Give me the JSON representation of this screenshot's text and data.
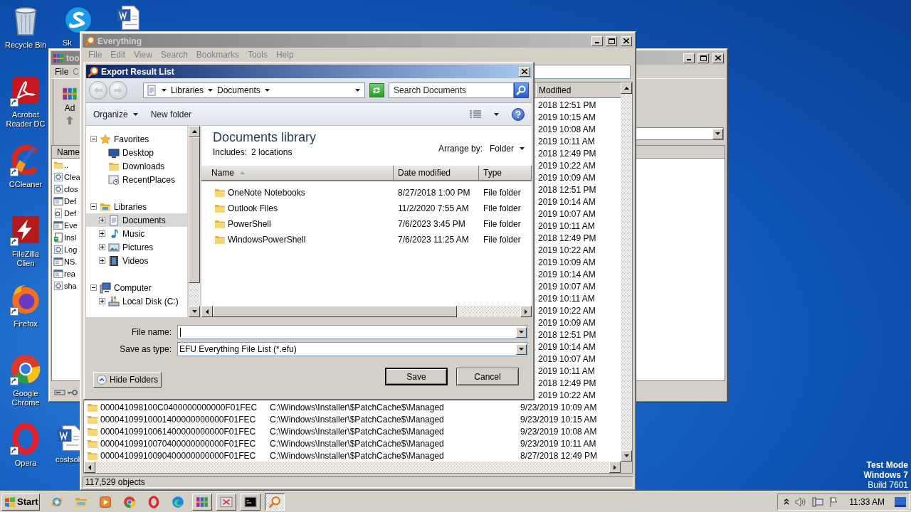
{
  "desktop": {
    "icons": [
      {
        "kind": "bin",
        "label": "Recycle Bin"
      },
      {
        "kind": "acrobat",
        "label": "Acrobat Reader DC"
      },
      {
        "kind": "ccleaner",
        "label": "CCleaner"
      },
      {
        "kind": "filezilla",
        "label": "FileZilla Clien"
      },
      {
        "kind": "firefox",
        "label": "Firefox"
      },
      {
        "kind": "chrome",
        "label": "Google Chrome"
      },
      {
        "kind": "opera",
        "label": "Opera"
      }
    ],
    "other_icons": [
      {
        "kind": "skype",
        "label": "Sk"
      },
      {
        "kind": "word"
      },
      {
        "kind": "word",
        "label": "costsol"
      }
    ],
    "system_text": [
      "Test Mode",
      "Windows 7",
      "Build 7601"
    ]
  },
  "back_window": {
    "title": "too",
    "menu": [
      "File",
      "C"
    ],
    "toolbar_button": "Ad",
    "column": "Name",
    "files": [
      {
        "name": "..",
        "kind": "folder"
      },
      {
        "name": "Clea",
        "kind": "gear"
      },
      {
        "name": "clos",
        "kind": "gear"
      },
      {
        "name": "Def",
        "kind": "window"
      },
      {
        "name": "Def",
        "kind": "settings"
      },
      {
        "name": "Eve",
        "kind": "window"
      },
      {
        "name": "Insl",
        "kind": "setup"
      },
      {
        "name": "Log",
        "kind": "gear"
      },
      {
        "name": "NS.",
        "kind": "window"
      },
      {
        "name": "rea",
        "kind": "window"
      },
      {
        "name": "sha",
        "kind": "gear"
      }
    ]
  },
  "everything": {
    "title": "Everything",
    "menu": [
      "File",
      "Edit",
      "View",
      "Search",
      "Bookmarks",
      "Tools",
      "Help"
    ],
    "header": "Modified",
    "covered_rows": [
      "2018 12:51 PM",
      "2019 10:15 AM",
      "2019 10:08 AM",
      "2019 10:11 AM",
      "2018 12:49 PM",
      "2019 10:22 AM",
      "2019 10:09 AM",
      "2018 12:51 PM",
      "2019 10:14 AM",
      "2019 10:07 AM",
      "2019 10:11 AM",
      "2018 12:49 PM",
      "2019 10:22 AM",
      "2019 10:09 AM",
      "2019 10:14 AM",
      "2019 10:07 AM",
      "2019 10:11 AM",
      "2019 10:22 AM",
      "2019 10:09 AM",
      "2018 12:51 PM",
      "2019 10:14 AM",
      "2019 10:07 AM",
      "2019 10:11 AM",
      "2018 12:49 PM",
      "2019 10:22 AM"
    ],
    "rows": [
      {
        "name": "000041098100C0400000000000F01FEC",
        "path": "C:\\Windows\\Installer\\$PatchCache$\\Managed",
        "modified": "9/23/2019 10:09 AM"
      },
      {
        "name": "00004109910001400000000000F01FEC",
        "path": "C:\\Windows\\Installer\\$PatchCache$\\Managed",
        "modified": "9/23/2019 10:15 AM"
      },
      {
        "name": "00004109910061400000000000F01FEC",
        "path": "C:\\Windows\\Installer\\$PatchCache$\\Managed",
        "modified": "9/23/2019 10:08 AM"
      },
      {
        "name": "00004109910070400000000000F01FEC",
        "path": "C:\\Windows\\Installer\\$PatchCache$\\Managed",
        "modified": "9/23/2019 10:11 AM"
      },
      {
        "name": "00004109910090400000000000F01FEC",
        "path": "C:\\Windows\\Installer\\$PatchCache$\\Managed",
        "modified": "8/27/2018 12:49 PM"
      }
    ],
    "status": "117,529 objects"
  },
  "dialog": {
    "title": "Export Result List",
    "breadcrumb": [
      "Libraries",
      "Documents"
    ],
    "search_placeholder": "Search Documents",
    "commands": [
      "Organize",
      "New folder"
    ],
    "nav": [
      {
        "label": "Favorites",
        "kind": "star",
        "expanded": true,
        "selected": false,
        "children": [
          {
            "label": "Desktop",
            "kind": "desktop",
            "selected": false
          },
          {
            "label": "Downloads",
            "kind": "folder",
            "selected": false
          },
          {
            "label": "RecentPlaces",
            "kind": "recent",
            "selected": false
          }
        ]
      },
      {
        "label": "Libraries",
        "kind": "libraries",
        "expanded": true,
        "selected": false,
        "children": [
          {
            "label": "Documents",
            "kind": "documents",
            "expanded": false,
            "selected": true
          },
          {
            "label": "Music",
            "kind": "music",
            "expanded": false,
            "selected": false
          },
          {
            "label": "Pictures",
            "kind": "pictures",
            "expanded": false,
            "selected": false
          },
          {
            "label": "Videos",
            "kind": "videos",
            "expanded": false,
            "selected": false
          }
        ]
      },
      {
        "label": "Computer",
        "kind": "computer",
        "expanded": true,
        "selected": false,
        "children": [
          {
            "label": "Local Disk (C:)",
            "kind": "disk",
            "expanded": false,
            "selected": false
          }
        ]
      }
    ],
    "library": {
      "title": "Documents library",
      "includes_label": "Includes:",
      "includes_value": "2 locations",
      "arrange_label": "Arrange by:",
      "arrange_value": "Folder"
    },
    "columns": [
      "Name",
      "Date modified",
      "Type"
    ],
    "files": [
      {
        "name": "OneNote Notebooks",
        "date": "8/27/2018 1:00 PM",
        "type": "File folder"
      },
      {
        "name": "Outlook Files",
        "date": "11/2/2020 7:55 AM",
        "type": "File folder"
      },
      {
        "name": "PowerShell",
        "date": "7/6/2023 3:45 PM",
        "type": "File folder"
      },
      {
        "name": "WindowsPowerShell",
        "date": "7/6/2023 11:25 AM",
        "type": "File folder"
      }
    ],
    "file_name_label": "File name:",
    "save_type_label": "Save as type:",
    "save_type_value": "EFU Everything File List (*.efu)",
    "hide_folders": "Hide Folders",
    "buttons": [
      "Save",
      "Cancel"
    ]
  },
  "taskbar": {
    "start": "Start",
    "apps": [
      {
        "kind": "ie",
        "running": false,
        "selected": false
      },
      {
        "kind": "explorer",
        "running": false,
        "selected": false
      },
      {
        "kind": "media",
        "running": false,
        "selected": false
      },
      {
        "kind": "chrome",
        "running": false,
        "selected": false
      },
      {
        "kind": "opera",
        "running": false,
        "selected": false
      },
      {
        "kind": "edge",
        "running": false,
        "selected": false
      },
      {
        "kind": "winrar",
        "running": true,
        "selected": false
      },
      {
        "kind": "app",
        "running": true,
        "selected": false
      },
      {
        "kind": "cmd",
        "running": true,
        "selected": false
      },
      {
        "kind": "everything",
        "running": true,
        "selected": true
      }
    ],
    "clock": "11:33 AM"
  }
}
